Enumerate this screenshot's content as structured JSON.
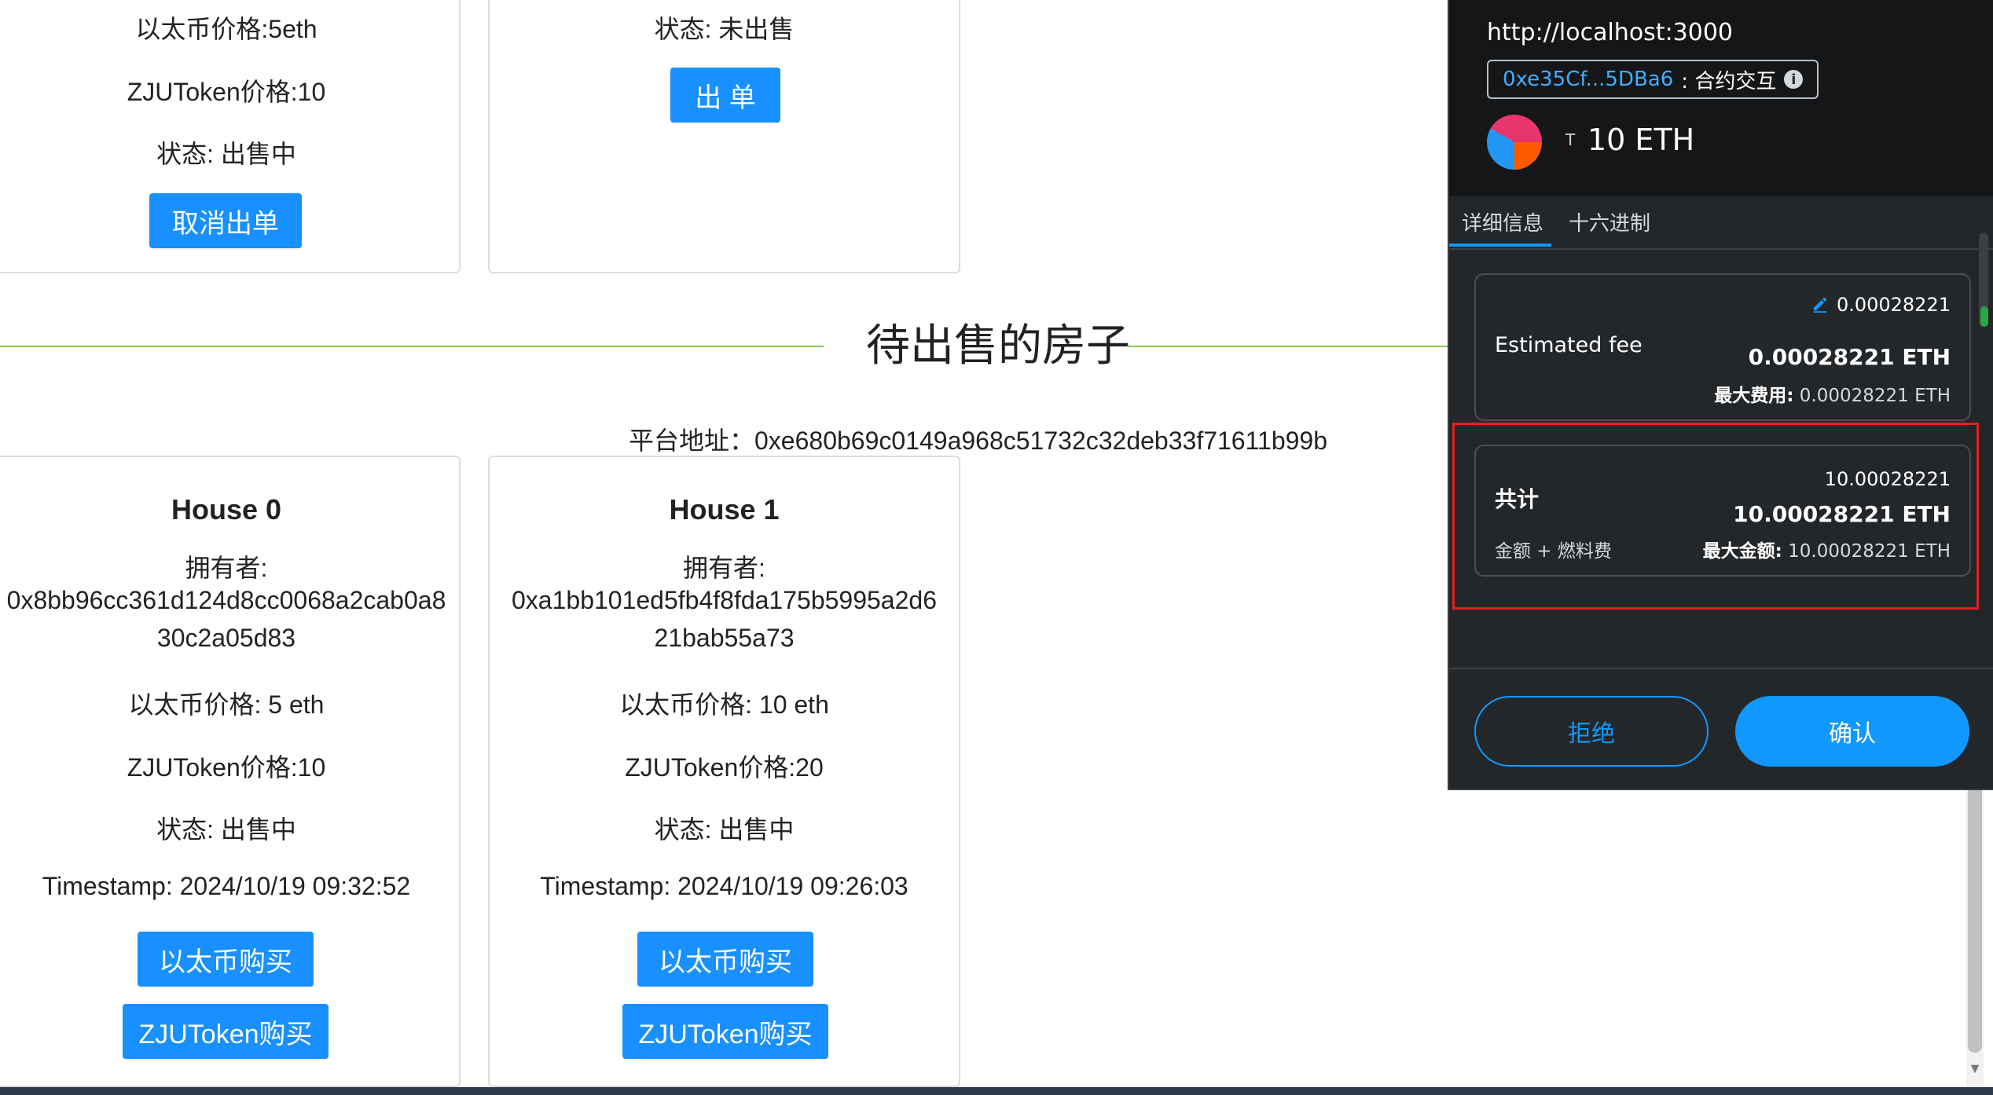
{
  "top_cards": [
    {
      "eth_price": "以太币价格:5eth",
      "zju_price": "ZJUToken价格:10",
      "status": "状态: 出售中",
      "button": "取消出单"
    },
    {
      "status": "状态: 未出售",
      "button": "出 单"
    }
  ],
  "section": {
    "title": "待出售的房子",
    "platform_address": "平台地址：0xe680b69c0149a968c51732c32deb33f71611b99b"
  },
  "houses": [
    {
      "name": "House 0",
      "owner_label": "拥有者:",
      "owner_line1": "0x8bb96cc361d124d8cc0068a2cab0a8",
      "owner_line2": "30c2a05d83",
      "eth_price": "以太币价格: 5 eth",
      "zju_price": "ZJUToken价格:10",
      "status": "状态: 出售中",
      "timestamp": "Timestamp: 2024/10/19 09:32:52",
      "buy_eth": "以太币购买",
      "buy_zju": "ZJUToken购买"
    },
    {
      "name": "House 1",
      "owner_label": "拥有者:",
      "owner_line1": "0xa1bb101ed5fb4f8fda175b5995a2d6",
      "owner_line2": "21bab55a73",
      "eth_price": "以太币价格: 10 eth",
      "zju_price": "ZJUToken价格:20",
      "status": "状态: 出售中",
      "timestamp": "Timestamp: 2024/10/19 09:26:03",
      "buy_eth": "以太币购买",
      "buy_zju": "ZJUToken购买"
    }
  ],
  "wallet": {
    "origin": "http://localhost:3000",
    "contract_address": "0xe35Cf...5DBa6",
    "contract_label": ": 合约交互",
    "info_icon": "i",
    "network_prefix": "T",
    "amount": "10 ETH",
    "tabs": [
      "详细信息",
      "十六进制"
    ],
    "fee": {
      "label": "Estimated fee",
      "value_small": "0.00028221",
      "value_bold": "0.00028221 ETH",
      "max_label": "最大费用:",
      "max_value": "0.00028221 ETH"
    },
    "total": {
      "label": "共计",
      "sub_label": "金额 + 燃料费",
      "value_small": "10.00028221",
      "value_bold": "10.00028221 ETH",
      "max_label": "最大金额:",
      "max_value": "10.00028221 ETH"
    },
    "reject": "拒绝",
    "confirm": "确认"
  },
  "colors": {
    "primary_button": "#1890ff",
    "divider": "#8bc34a",
    "wallet_bg": "#24272a",
    "wallet_accent": "#1098fc",
    "highlight": "#e02020"
  }
}
